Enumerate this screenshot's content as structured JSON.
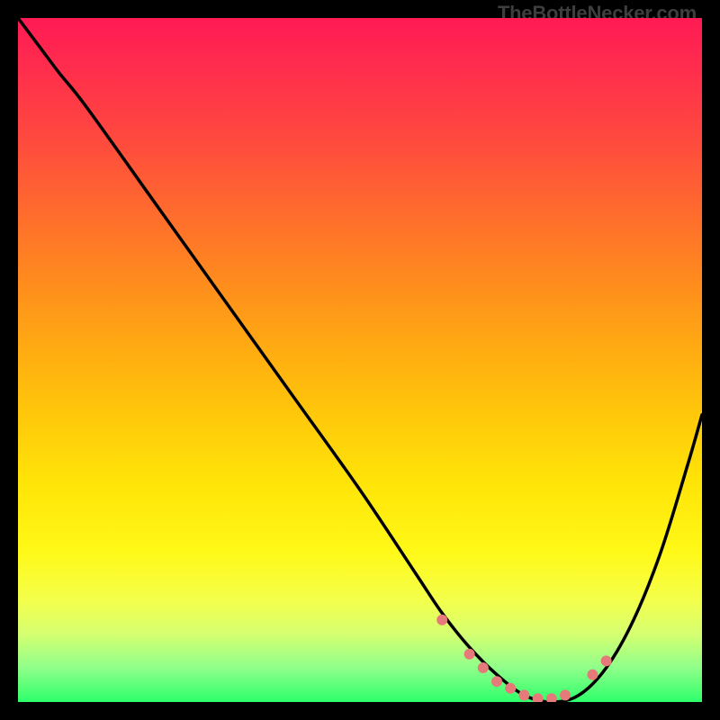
{
  "attribution": "TheBottleNecker.com",
  "chart_data": {
    "type": "line",
    "title": "",
    "xlabel": "",
    "ylabel": "",
    "xlim": [
      0,
      100
    ],
    "ylim": [
      0,
      100
    ],
    "series": [
      {
        "name": "curve",
        "x": [
          0,
          3,
          6,
          10,
          20,
          30,
          40,
          50,
          58,
          62,
          66,
          70,
          74,
          78,
          82,
          86,
          90,
          94,
          98,
          100
        ],
        "y": [
          100,
          96,
          92,
          87,
          73,
          59,
          45,
          31,
          19,
          13,
          8,
          4,
          1,
          0,
          1,
          5,
          12,
          22,
          35,
          42
        ]
      }
    ],
    "markers": [
      {
        "x": 62,
        "y": 12,
        "color": "#e67a7a"
      },
      {
        "x": 66,
        "y": 7,
        "color": "#e67a7a"
      },
      {
        "x": 68,
        "y": 5,
        "color": "#e67a7a"
      },
      {
        "x": 70,
        "y": 3,
        "color": "#e67a7a"
      },
      {
        "x": 72,
        "y": 2,
        "color": "#e67a7a"
      },
      {
        "x": 74,
        "y": 1,
        "color": "#e67a7a"
      },
      {
        "x": 76,
        "y": 0.5,
        "color": "#e67a7a"
      },
      {
        "x": 78,
        "y": 0.5,
        "color": "#e67a7a"
      },
      {
        "x": 80,
        "y": 1,
        "color": "#e67a7a"
      },
      {
        "x": 84,
        "y": 4,
        "color": "#e67a7a"
      },
      {
        "x": 86,
        "y": 6,
        "color": "#e67a7a"
      }
    ],
    "gradient_stops": [
      {
        "pos": 0.0,
        "color": "#ff1a54"
      },
      {
        "pos": 0.38,
        "color": "#ff8a1e"
      },
      {
        "pos": 0.7,
        "color": "#ffe408"
      },
      {
        "pos": 0.92,
        "color": "#b0ff7a"
      },
      {
        "pos": 1.0,
        "color": "#2dff6a"
      }
    ]
  }
}
